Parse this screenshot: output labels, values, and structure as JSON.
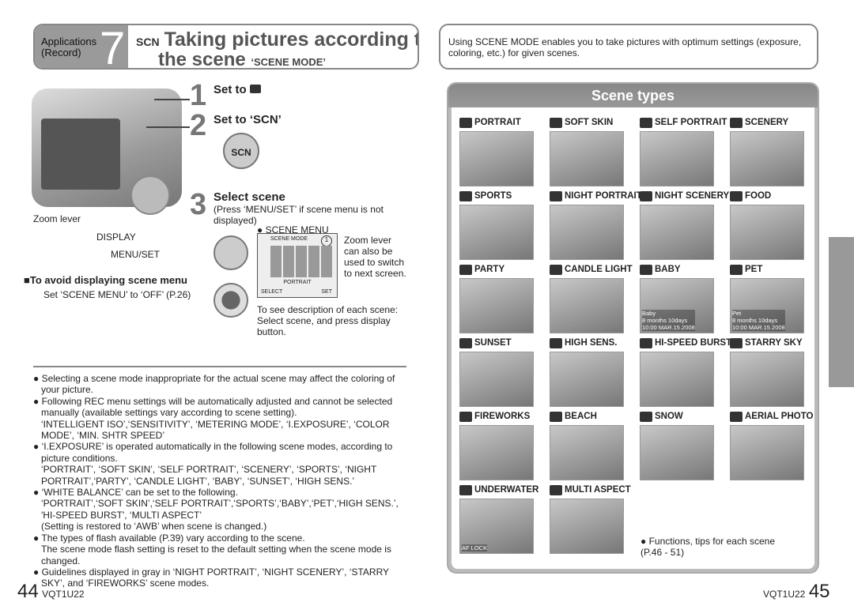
{
  "header_left": {
    "section": "Applications",
    "section_sub": "(Record)",
    "chapter": "7",
    "scn_icon": "SCN",
    "title_line1": "Taking pictures according to",
    "title_line2": "the scene",
    "title_suffix": "‘SCENE MODE’"
  },
  "header_right": {
    "text": "Using SCENE MODE enables you to take pictures with optimum settings (exposure, coloring, etc.) for given scenes."
  },
  "camera_labels": {
    "zoom_lever": "Zoom lever",
    "display": "DISPLAY",
    "menu_set": "MENU/SET"
  },
  "steps": [
    {
      "num": "1",
      "title": "Set to",
      "icon": "camera-icon"
    },
    {
      "num": "2",
      "title": "Set to ‘SCN’",
      "dial": "SCN"
    },
    {
      "num": "3",
      "title": "Select scene",
      "desc": "(Press ‘MENU/SET’ if scene menu is not displayed)"
    }
  ],
  "scene_menu": {
    "label": "SCENE MENU",
    "screen_title": "SCENE MODE",
    "page": "1",
    "selected": "PORTRAIT",
    "footer_select": "SELECT",
    "footer_set": "SET",
    "zoom_note": "Zoom lever can also be used to switch to next screen.",
    "display_note": "To see description of each scene: Select scene, and press display button."
  },
  "avoid": {
    "title": "■To avoid displaying scene menu",
    "text": "Set ‘SCENE MENU’ to ‘OFF’ (P.26)"
  },
  "notes": [
    {
      "bullet": true,
      "text": "Selecting a scene mode inappropriate for the actual scene may affect the coloring of your picture."
    },
    {
      "bullet": true,
      "text": "Following REC menu settings will be automatically adjusted and cannot be selected manually (available settings vary according to scene setting)."
    },
    {
      "bullet": false,
      "text": "‘INTELLIGENT ISO’,‘SENSITIVITY’, ‘METERING MODE’, ‘I.EXPOSURE’, ‘COLOR MODE’, ‘MIN. SHTR SPEED’"
    },
    {
      "bullet": true,
      "text": "‘I.EXPOSURE’ is operated automatically in the following scene modes, according to picture conditions."
    },
    {
      "bullet": false,
      "text": "‘PORTRAIT’, ‘SOFT SKIN’, ‘SELF PORTRAIT’, ‘SCENERY’, ‘SPORTS’, ‘NIGHT PORTRAIT’,‘PARTY’, ‘CANDLE LIGHT’, ‘BABY’, ‘SUNSET’, ‘HIGH SENS.’"
    },
    {
      "bullet": true,
      "text": "‘WHITE BALANCE’ can be set to the following."
    },
    {
      "bullet": false,
      "text": "‘PORTRAIT’,‘SOFT SKIN’,‘SELF PORTRAIT’,‘SPORTS’,‘BABY’,‘PET’,‘HIGH SENS.’, 'HI-SPEED BURST', ‘MULTI ASPECT’"
    },
    {
      "bullet": false,
      "text": "(Setting is restored to ‘AWB’ when scene is changed.)"
    },
    {
      "bullet": true,
      "text": "The types of flash available (P.39) vary according to the scene."
    },
    {
      "bullet": false,
      "text": "The scene mode flash setting is reset to the default setting when the scene mode is changed."
    },
    {
      "bullet": true,
      "text": "Guidelines displayed in gray in ‘NIGHT PORTRAIT’, ‘NIGHT SCENERY’, ‘STARRY SKY’, and ‘FIREWORKS’ scene modes."
    }
  ],
  "scene_types": {
    "title": "Scene types",
    "items": [
      {
        "label": "PORTRAIT"
      },
      {
        "label": "SOFT SKIN"
      },
      {
        "label": "SELF PORTRAIT"
      },
      {
        "label": "SCENERY"
      },
      {
        "label": "SPORTS"
      },
      {
        "label": "NIGHT PORTRAIT"
      },
      {
        "label": "NIGHT SCENERY"
      },
      {
        "label": "FOOD"
      },
      {
        "label": "PARTY"
      },
      {
        "label": "CANDLE LIGHT"
      },
      {
        "label": "BABY",
        "overlay": [
          "Baby",
          "8 months 10days",
          "10:00 MAR.15.2008"
        ]
      },
      {
        "label": "PET",
        "overlay": [
          "Pet",
          "8 months 10days",
          "10:00 MAR.15.2008"
        ]
      },
      {
        "label": "SUNSET"
      },
      {
        "label": "HIGH SENS."
      },
      {
        "label": "HI-SPEED BURST"
      },
      {
        "label": "STARRY SKY"
      },
      {
        "label": "FIREWORKS"
      },
      {
        "label": "BEACH"
      },
      {
        "label": "SNOW"
      },
      {
        "label": "AERIAL PHOTO"
      },
      {
        "label": "UNDERWATER",
        "overlay": [
          "AF LOCK"
        ]
      },
      {
        "label": "MULTI ASPECT"
      }
    ],
    "footnote": "Functions, tips for each scene (P.46 - 51)"
  },
  "footer": {
    "left_page": "44",
    "left_code": "VQT1U22",
    "right_code": "VQT1U22",
    "right_page": "45"
  }
}
